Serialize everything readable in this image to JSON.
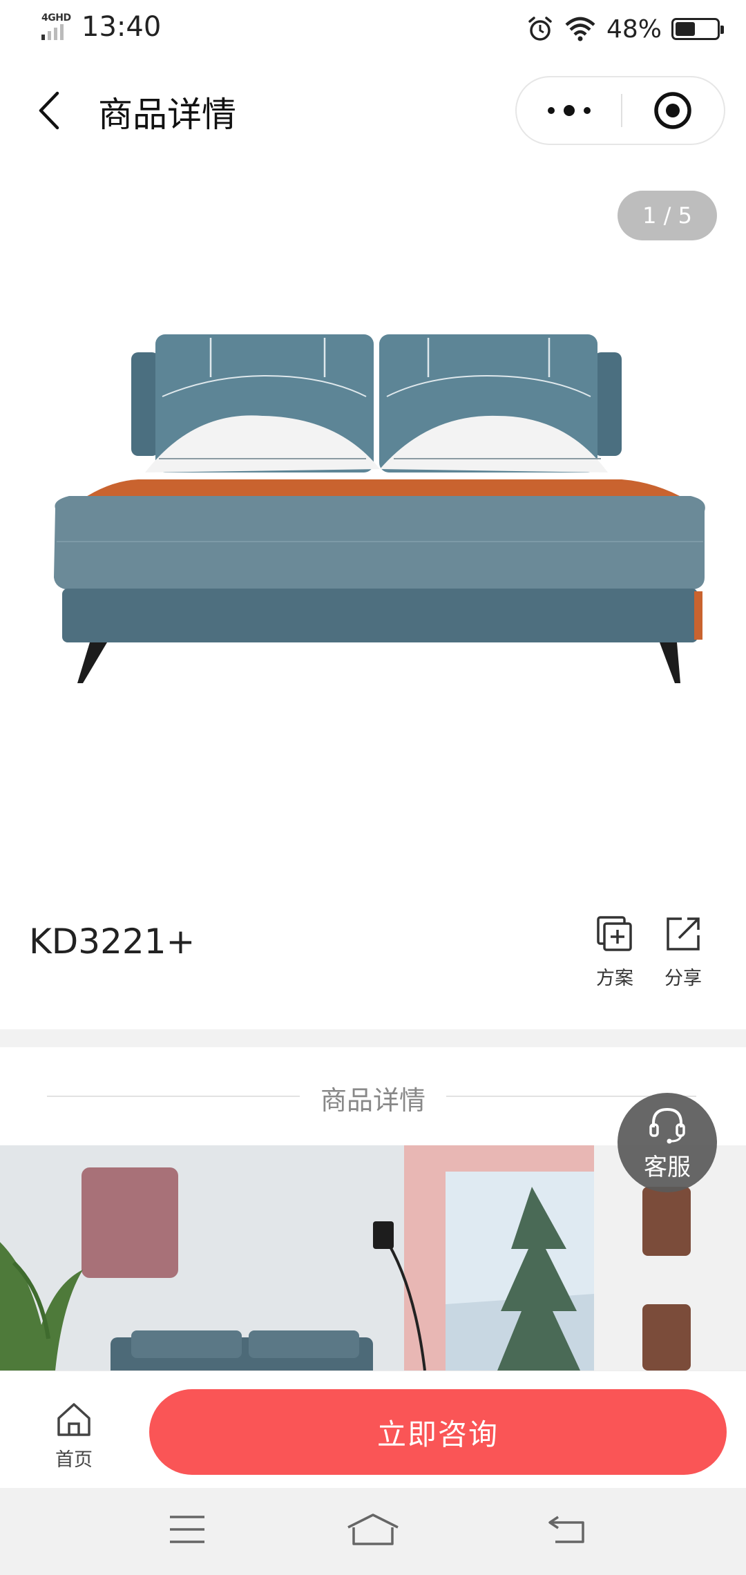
{
  "status_bar": {
    "network": "4GHD",
    "time": "13:40",
    "battery_percent": "48%",
    "battery_level": 0.48,
    "icons": [
      "alarm-icon",
      "wifi-icon",
      "battery-icon"
    ]
  },
  "nav": {
    "title": "商品详情",
    "icons": [
      "back-chevron-icon",
      "more-dots-icon",
      "close-target-icon"
    ]
  },
  "gallery": {
    "indicator": "1 / 5",
    "current": 1,
    "total": 5
  },
  "product": {
    "code": "KD3221+",
    "actions": {
      "plan": "方案",
      "share": "分享"
    }
  },
  "details": {
    "title": "商品详情"
  },
  "service": {
    "label": "客服"
  },
  "bottom_bar": {
    "home_label": "首页",
    "consult_label": "立即咨询"
  },
  "colors": {
    "accent": "#fa5556",
    "indicator_bg": "#bdbdbd",
    "service_bg": "#5a5a5a"
  }
}
